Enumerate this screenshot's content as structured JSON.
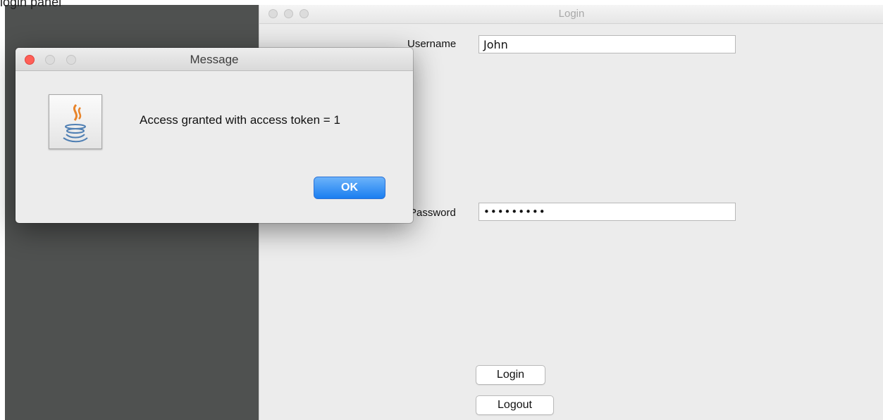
{
  "background_caption": "login panel",
  "login_window": {
    "title": "Login",
    "username_label": "Username",
    "username_value": "John",
    "password_label": "Password",
    "password_value": "•••••••••",
    "login_button": "Login",
    "logout_button": "Logout"
  },
  "message_dialog": {
    "title": "Message",
    "icon": "java-icon",
    "message": "Access granted with access token = 1",
    "ok_button": "OK"
  },
  "colors": {
    "desktop": "#4f5150",
    "window_bg": "#ececec",
    "ok_button_blue": "#1a7ef0",
    "close_red": "#ff5f57"
  }
}
